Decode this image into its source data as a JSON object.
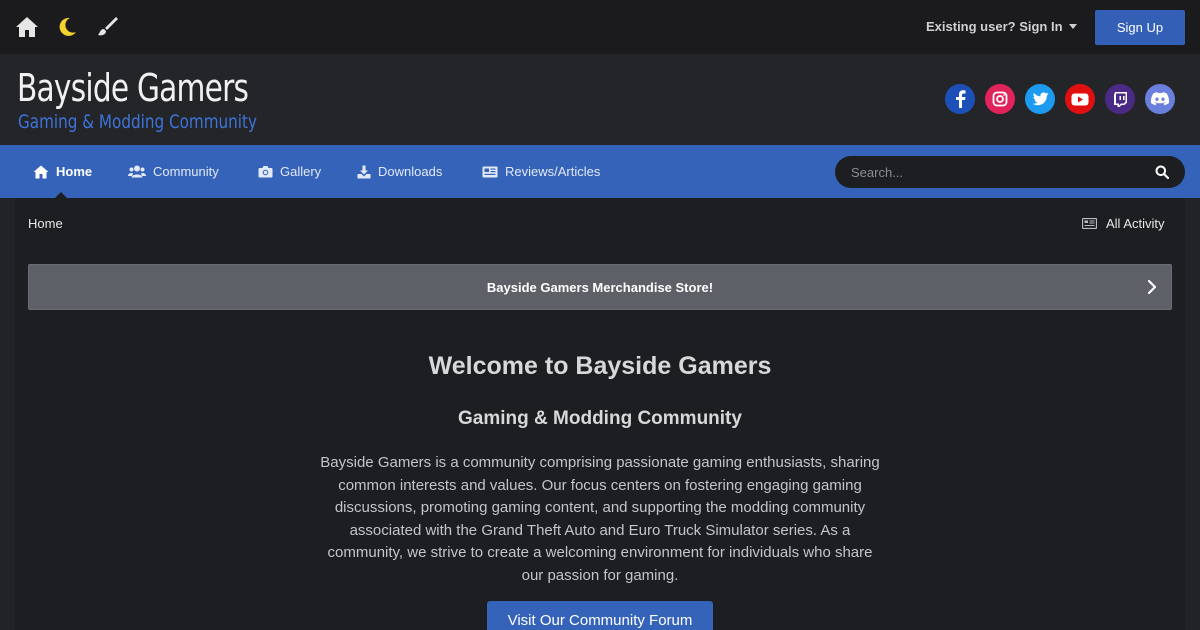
{
  "topbar": {
    "icons": [
      "home-icon",
      "moon-icon",
      "paintbrush-icon"
    ],
    "signin_label": "Existing user? Sign In",
    "signup_label": "Sign Up"
  },
  "brand": {
    "title": "Bayside Gamers",
    "subtitle": "Gaming & Modding Community",
    "subtitle_color": "#3d74db"
  },
  "social": [
    {
      "icon": "facebook-icon",
      "color": "#1d4fb8"
    },
    {
      "icon": "instagram-icon",
      "color": "#e0235a"
    },
    {
      "icon": "twitter-icon",
      "color": "#1d9bf0"
    },
    {
      "icon": "youtube-icon",
      "color": "#e01010"
    },
    {
      "icon": "twitch-icon",
      "color": "#4b2a85"
    },
    {
      "icon": "discord-icon",
      "color": "#6a7fdc"
    }
  ],
  "nav": {
    "items": [
      {
        "label": "Home",
        "icon": "home-icon",
        "active": true
      },
      {
        "label": "Community",
        "icon": "users-icon"
      },
      {
        "label": "Gallery",
        "icon": "camera-icon"
      },
      {
        "label": "Downloads",
        "icon": "download-icon"
      },
      {
        "label": "Reviews/Articles",
        "icon": "newspaper-icon"
      }
    ],
    "search_placeholder": "Search..."
  },
  "breadcrumb": {
    "home": "Home",
    "all_activity": "All Activity"
  },
  "banner": {
    "label": "Bayside Gamers Merchandise Store!"
  },
  "main": {
    "heading": "Welcome to Bayside Gamers",
    "subheading": "Gaming & Modding Community",
    "description": "Bayside Gamers is a community comprising passionate gaming enthusiasts, sharing common interests and values. Our focus centers on fostering engaging gaming discussions, promoting gaming content, and supporting the modding community associated with the Grand Theft Auto and Euro Truck Simulator series. As a community, we strive to create a welcoming environment for individuals who share our passion for gaming.",
    "cta_label": "Visit Our Community Forum"
  },
  "colors": {
    "accent": "#3563b9",
    "background": "#1d1e21"
  }
}
